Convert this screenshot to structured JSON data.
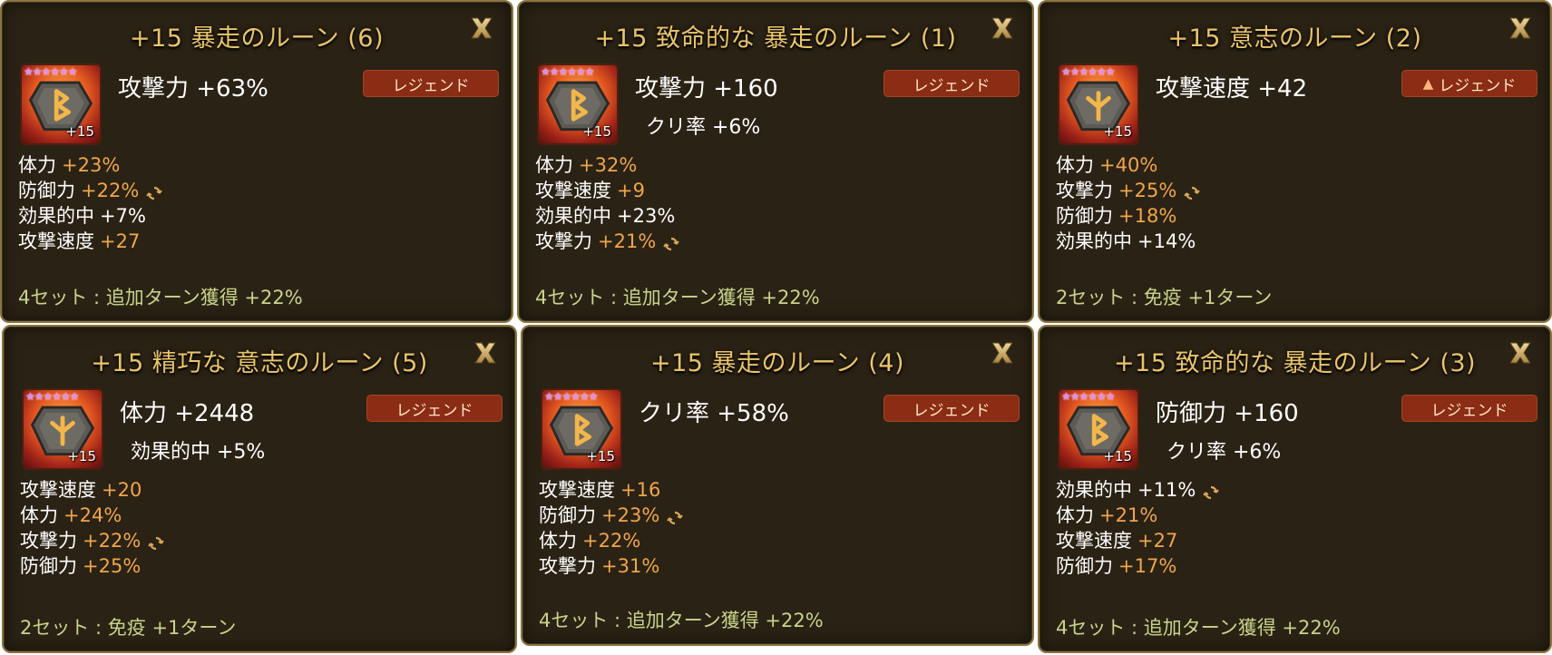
{
  "colors": {
    "panel_bg": "#2a2214",
    "panel_border": "#8a7440",
    "title": "#e9c46a",
    "grade_bg": "#8b2c14",
    "stat_value": "#f0a54b",
    "set_text": "#c8d48a"
  },
  "icons": {
    "close": "close-x-icon",
    "reapplied": "refresh-icon",
    "ancient": "ancient-triangle-icon",
    "star": "star-icon"
  },
  "runes": [
    {
      "title": "+15 暴走のルーン (6)",
      "stars": "★★★★★★",
      "level": "+15",
      "rune_glyph": "B",
      "grade": "レジェンド",
      "ancient": false,
      "main": "攻撃力 +63%",
      "prefix": "",
      "subs": [
        {
          "name": "体力",
          "value": "+23%",
          "reapplied": false,
          "plain": false
        },
        {
          "name": "防御力",
          "value": "+22%",
          "reapplied": true,
          "plain": false
        },
        {
          "name": "効果的中",
          "value": "+7%",
          "reapplied": false,
          "plain": true
        },
        {
          "name": "攻撃速度",
          "value": "+27",
          "reapplied": false,
          "plain": false
        }
      ],
      "set": "4セット : 追加ターン獲得 +22%"
    },
    {
      "title": "+15 致命的な 暴走のルーン (1)",
      "stars": "★★★★★★",
      "level": "+15",
      "rune_glyph": "B",
      "grade": "レジェンド",
      "ancient": false,
      "main": "攻撃力 +160",
      "prefix": "クリ率 +6%",
      "subs": [
        {
          "name": "体力",
          "value": "+32%",
          "reapplied": false,
          "plain": false
        },
        {
          "name": "攻撃速度",
          "value": "+9",
          "reapplied": false,
          "plain": false
        },
        {
          "name": "効果的中",
          "value": "+23%",
          "reapplied": false,
          "plain": true
        },
        {
          "name": "攻撃力",
          "value": "+21%",
          "reapplied": true,
          "plain": false
        }
      ],
      "set": "4セット : 追加ターン獲得 +22%"
    },
    {
      "title": "+15 意志のルーン (2)",
      "stars": "★★★★★★",
      "level": "+15",
      "rune_glyph": "W",
      "grade": "レジェンド",
      "ancient": true,
      "main": "攻撃速度 +42",
      "prefix": "",
      "subs": [
        {
          "name": "体力",
          "value": "+40%",
          "reapplied": false,
          "plain": false
        },
        {
          "name": "攻撃力",
          "value": "+25%",
          "reapplied": true,
          "plain": false
        },
        {
          "name": "防御力",
          "value": "+18%",
          "reapplied": false,
          "plain": false
        },
        {
          "name": "効果的中",
          "value": "+14%",
          "reapplied": false,
          "plain": true
        }
      ],
      "set": "2セット : 免疫 +1ターン"
    },
    {
      "title": "+15 精巧な 意志のルーン (5)",
      "stars": "★★★★★★",
      "level": "+15",
      "rune_glyph": "W",
      "grade": "レジェンド",
      "ancient": false,
      "main": "体力 +2448",
      "prefix": "効果的中 +5%",
      "subs": [
        {
          "name": "攻撃速度",
          "value": "+20",
          "reapplied": false,
          "plain": false
        },
        {
          "name": "体力",
          "value": "+24%",
          "reapplied": false,
          "plain": false
        },
        {
          "name": "攻撃力",
          "value": "+22%",
          "reapplied": true,
          "plain": false
        },
        {
          "name": "防御力",
          "value": "+25%",
          "reapplied": false,
          "plain": false
        }
      ],
      "set": "2セット : 免疫 +1ターン"
    },
    {
      "title": "+15 暴走のルーン (4)",
      "stars": "★★★★★★",
      "level": "+15",
      "rune_glyph": "B",
      "grade": "レジェンド",
      "ancient": false,
      "main": "クリ率 +58%",
      "prefix": "",
      "subs": [
        {
          "name": "攻撃速度",
          "value": "+16",
          "reapplied": false,
          "plain": false
        },
        {
          "name": "防御力",
          "value": "+23%",
          "reapplied": true,
          "plain": false
        },
        {
          "name": "体力",
          "value": "+22%",
          "reapplied": false,
          "plain": false
        },
        {
          "name": "攻撃力",
          "value": "+31%",
          "reapplied": false,
          "plain": false
        }
      ],
      "set": "4セット : 追加ターン獲得 +22%"
    },
    {
      "title": "+15 致命的な 暴走のルーン (3)",
      "stars": "★★★★★★",
      "level": "+15",
      "rune_glyph": "B",
      "grade": "レジェンド",
      "ancient": false,
      "main": "防御力 +160",
      "prefix": "クリ率 +6%",
      "subs": [
        {
          "name": "効果的中",
          "value": "+11%",
          "reapplied": true,
          "plain": true
        },
        {
          "name": "体力",
          "value": "+21%",
          "reapplied": false,
          "plain": false
        },
        {
          "name": "攻撃速度",
          "value": "+27",
          "reapplied": false,
          "plain": false
        },
        {
          "name": "防御力",
          "value": "+17%",
          "reapplied": false,
          "plain": false
        }
      ],
      "set": "4セット : 追加ターン獲得 +22%"
    }
  ]
}
